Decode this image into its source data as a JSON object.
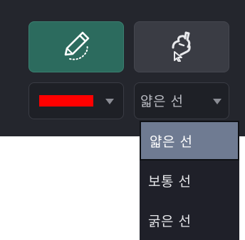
{
  "toolbar": {
    "tools": [
      {
        "name": "pencil",
        "icon": "pencil-icon",
        "active": true
      },
      {
        "name": "lasso",
        "icon": "lasso-icon",
        "active": false
      }
    ],
    "color_select": {
      "value": "#ff0000",
      "icon": "dropdown-caret-icon"
    },
    "width_select": {
      "value": "얇은 선",
      "icon": "dropdown-caret-icon"
    }
  },
  "width_menu": {
    "items": [
      {
        "label": "얇은 선",
        "selected": true
      },
      {
        "label": "보통 선",
        "selected": false
      },
      {
        "label": "굵은 선",
        "selected": false
      }
    ]
  },
  "colors": {
    "panel_bg": "#24262d",
    "active_tool": "#2c6b5e",
    "menu_selected": "#6f7b92"
  }
}
